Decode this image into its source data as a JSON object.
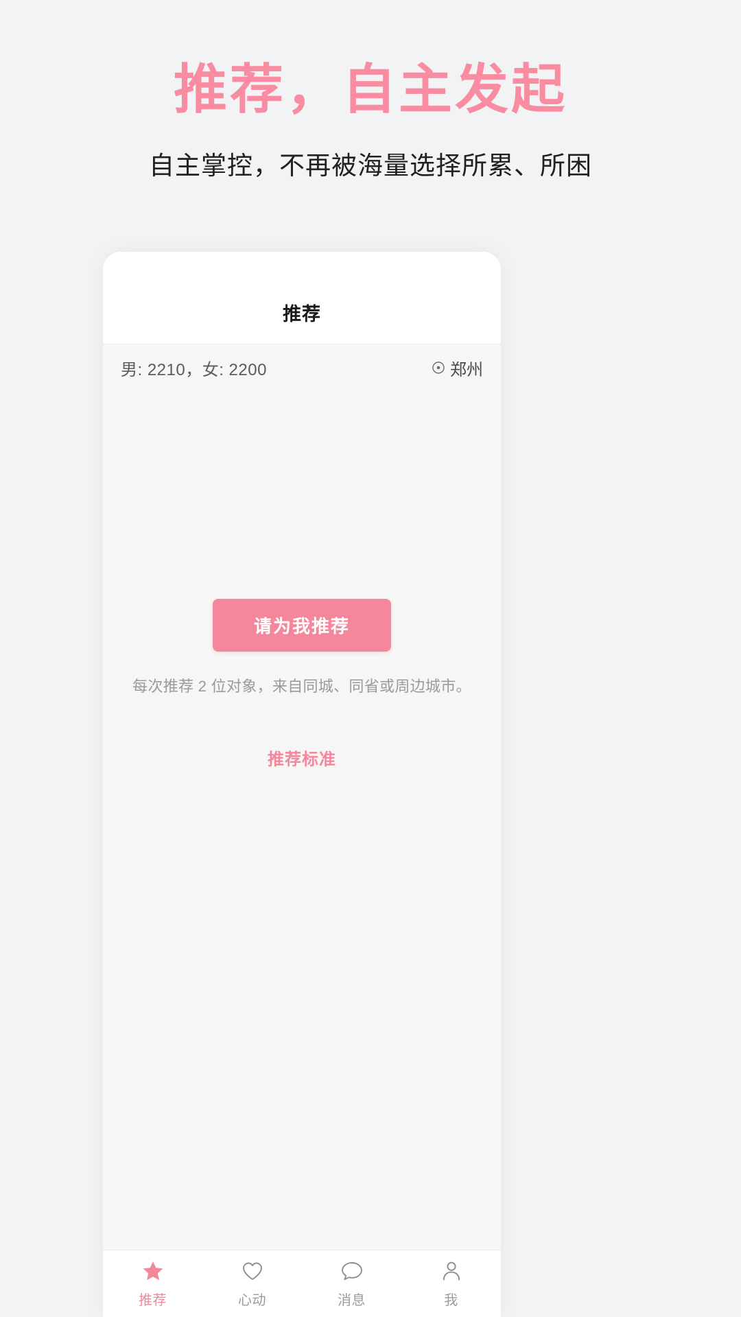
{
  "promo": {
    "title": "推荐，自主发起",
    "subtitle": "自主掌控，不再被海量选择所累、所困",
    "title_color": "#f98ca0",
    "subtitle_color": "#212121"
  },
  "phone": {
    "header": {
      "title": "推荐"
    },
    "stats": {
      "counts": "男: 2210，女: 2200",
      "location": "郑州",
      "location_icon": "location-pin-icon"
    },
    "main": {
      "cta_label": "请为我推荐",
      "cta_color": "#f5879c",
      "hint": "每次推荐 2 位对象，来自同城、同省或周边城市。",
      "standard_link": "推荐标准",
      "standard_link_color": "#f5879c"
    },
    "tabbar": {
      "items": [
        {
          "label": "推荐",
          "icon": "star-icon",
          "active": true
        },
        {
          "label": "心动",
          "icon": "heart-icon",
          "active": false
        },
        {
          "label": "消息",
          "icon": "chat-bubble-icon",
          "active": false
        },
        {
          "label": "我",
          "icon": "person-icon",
          "active": false
        }
      ],
      "active_color": "#f5879c",
      "inactive_color": "#9b9b9b"
    }
  }
}
